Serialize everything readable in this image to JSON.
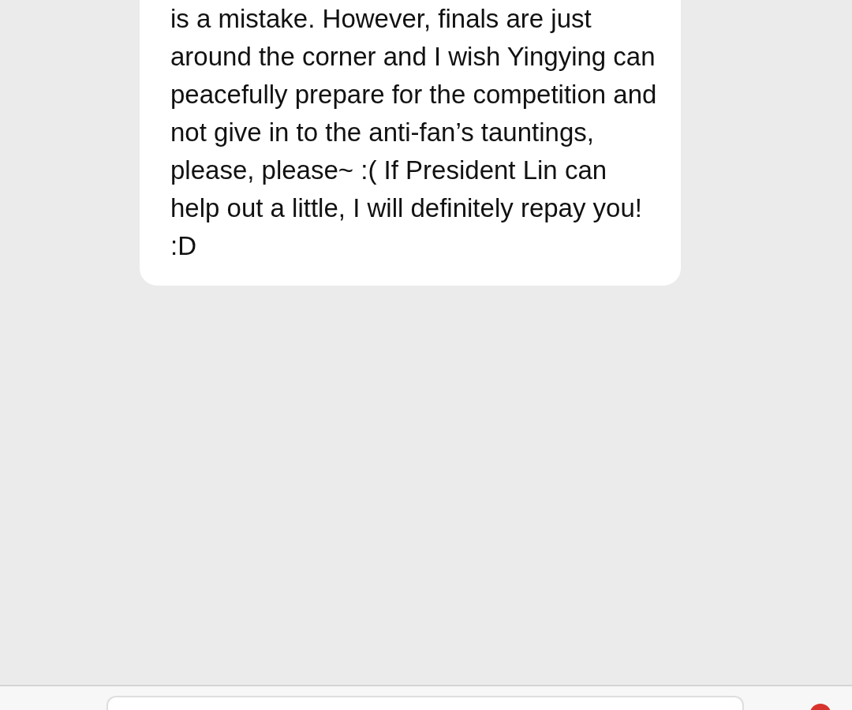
{
  "messages": [
    {
      "text": "is a mistake. However, finals are just around the corner and I wish Yingying can peacefully prepare for the competition and not give in to the anti-fan’s tauntings, please, please~ :( If President Lin can help out a little, I will definitely repay you! :D",
      "kind": "incoming"
    }
  ],
  "composer": {
    "kind": "text"
  }
}
